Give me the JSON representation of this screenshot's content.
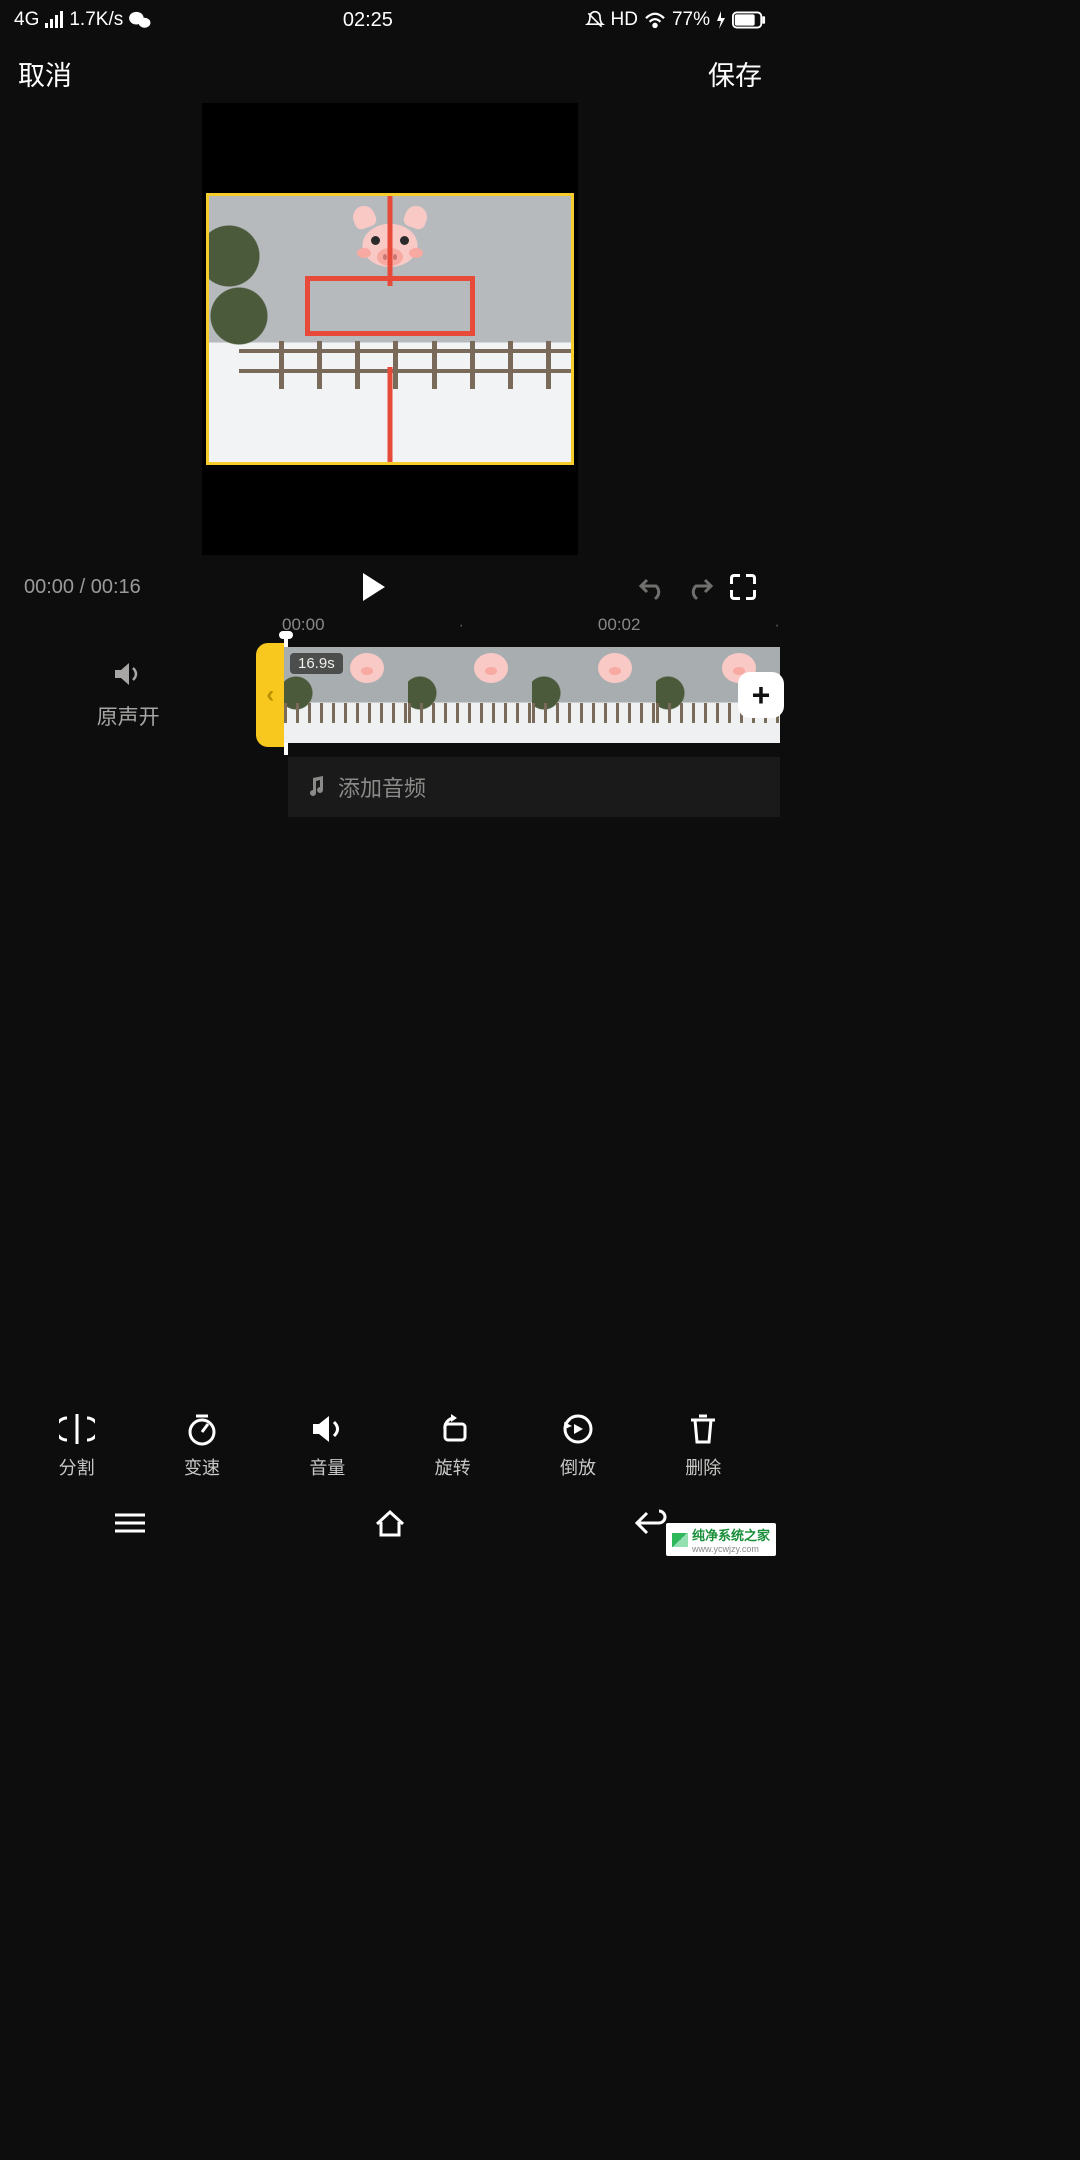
{
  "status": {
    "network": "4G",
    "speed": "1.7K/s",
    "time": "02:25",
    "hd": "HD",
    "battery_pct": "77%"
  },
  "header": {
    "cancel": "取消",
    "save": "保存"
  },
  "playback": {
    "current": "00:00",
    "sep": "/",
    "total": "00:16"
  },
  "ruler": {
    "t0": "00:00",
    "t1": "00:02"
  },
  "timeline": {
    "origin_label": "原声开",
    "clip_duration": "16.9s",
    "add_audio": "添加音频"
  },
  "tools": [
    {
      "label": "分割"
    },
    {
      "label": "变速"
    },
    {
      "label": "音量"
    },
    {
      "label": "旋转"
    },
    {
      "label": "倒放"
    },
    {
      "label": "删除"
    }
  ],
  "watermark": {
    "title": "纯净系统之家",
    "url": "www.ycwjzy.com"
  }
}
